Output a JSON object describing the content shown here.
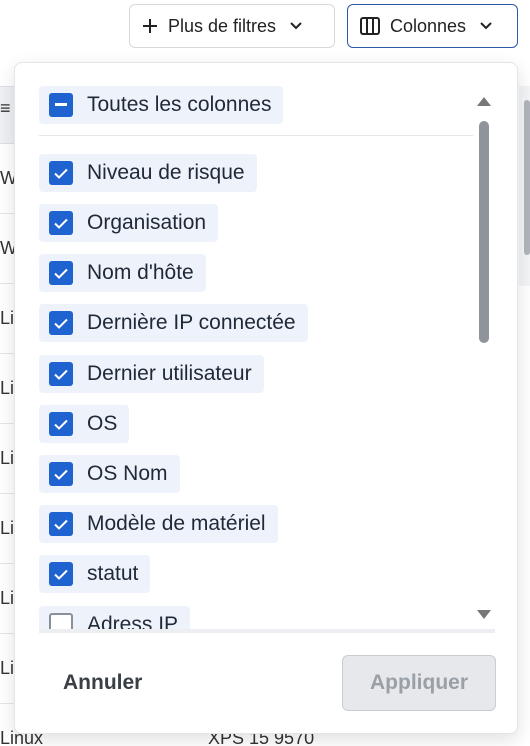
{
  "toolbar": {
    "more_filters_label": "Plus de filtres",
    "columns_label": "Colonnes"
  },
  "background_table": {
    "rows": [
      "W",
      "W",
      "Li",
      "Li",
      "Li",
      "Li",
      "Li",
      "Li"
    ],
    "last_row": {
      "os": "Linux",
      "model": "XPS 15 9570"
    }
  },
  "columns_menu": {
    "select_all_label": "Toutes les colonnes",
    "items": [
      {
        "label": "Niveau de risque",
        "checked": true
      },
      {
        "label": "Organisation",
        "checked": true
      },
      {
        "label": "Nom d'hôte",
        "checked": true
      },
      {
        "label": "Dernière IP connectée",
        "checked": true
      },
      {
        "label": "Dernier utilisateur",
        "checked": true
      },
      {
        "label": "OS",
        "checked": true
      },
      {
        "label": "OS Nom",
        "checked": true
      },
      {
        "label": "Modèle de matériel",
        "checked": true
      },
      {
        "label": "statut",
        "checked": true
      },
      {
        "label": "Adress IP",
        "checked": false
      }
    ],
    "cancel_label": "Annuler",
    "apply_label": "Appliquer"
  },
  "colors": {
    "accent": "#1f63d1",
    "chip_bg": "#eef3fb"
  }
}
